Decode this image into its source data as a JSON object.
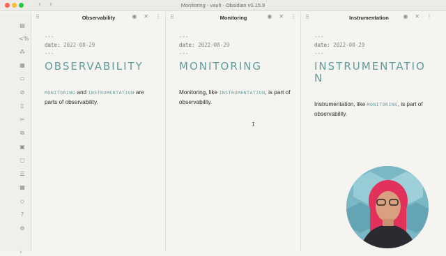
{
  "window": {
    "title": "Monitoring - vault - Obsidian v0.15.9",
    "back_arrow": "‹",
    "forward_arrow": "›"
  },
  "ribbon": {
    "icons": [
      "folder-icon",
      "code-icon",
      "graph-icon",
      "calendar-icon",
      "presentation-icon",
      "compass-icon",
      "file-icon",
      "scissors-icon",
      "copy-icon",
      "note-icon",
      "document-icon",
      "list-icon",
      "date-icon",
      "tag-icon",
      "help-icon",
      "settings-icon"
    ],
    "bottom_chevron": "›"
  },
  "panes": [
    {
      "title": "Observability",
      "frontmatter_open": "---",
      "date_key": "date:",
      "date_value": "2022-08-29",
      "frontmatter_close": "---",
      "heading": "OBSERVABILITY",
      "body_parts": [
        {
          "text": "MONITORING",
          "link": true
        },
        {
          "text": " and ",
          "link": false
        },
        {
          "text": "INSTRUMENTATION",
          "link": true
        },
        {
          "text": " are parts of observability.",
          "link": false
        }
      ]
    },
    {
      "title": "Monitoring",
      "frontmatter_open": "---",
      "date_key": "date:",
      "date_value": "2022-08-29",
      "frontmatter_close": "---",
      "heading": "MONITORING",
      "body_parts": [
        {
          "text": "Monitoring, like ",
          "link": false
        },
        {
          "text": "INSTRUMENTATION",
          "link": true
        },
        {
          "text": ", is part of observability.",
          "link": false
        }
      ]
    },
    {
      "title": "Instrumentation",
      "frontmatter_open": "---",
      "date_key": "date:",
      "date_value": "2022-08-29",
      "frontmatter_close": "---",
      "heading": "INSTRUMENTATION",
      "body_parts": [
        {
          "text": "Instrumentation, like ",
          "link": false
        },
        {
          "text": "MONITORING",
          "link": true
        },
        {
          "text": ", is part of observability.",
          "link": false
        }
      ]
    }
  ],
  "pane_actions": {
    "reading_view": "◉",
    "close": "✕",
    "more": "⋮",
    "drag": "⠿"
  },
  "text_cursor": "I"
}
